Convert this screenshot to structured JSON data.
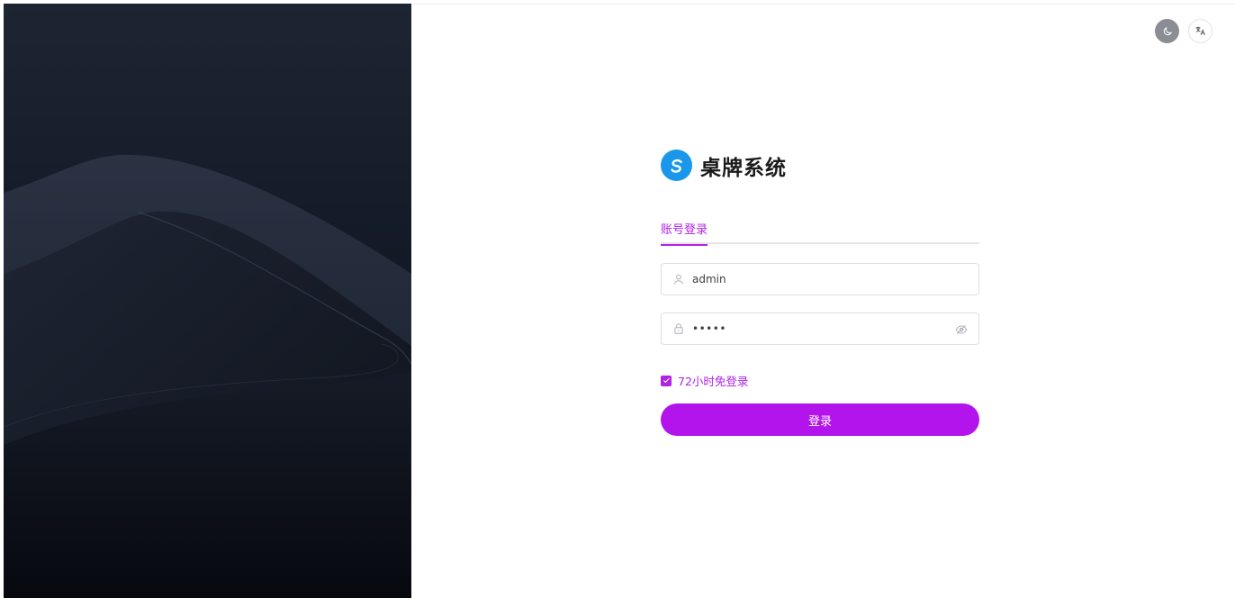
{
  "app": {
    "name": "桌牌系统"
  },
  "header": {
    "theme_toggle_icon": "moon-icon",
    "language_icon": "translate-icon"
  },
  "login": {
    "tabs": [
      {
        "label": "账号登录",
        "active": true
      }
    ],
    "username": {
      "value": "admin",
      "icon": "user-icon"
    },
    "password": {
      "masked_value": "•••••",
      "icon": "lock-icon",
      "toggle_icon": "eye-off-icon"
    },
    "remember": {
      "label": "72小时免登录",
      "checked": true
    },
    "submit_label": "登录"
  },
  "colors": {
    "accent": "#b022e6",
    "button": "#b414ec",
    "brand_logo": "#1a97ea",
    "hero_bg": "#151c29"
  }
}
